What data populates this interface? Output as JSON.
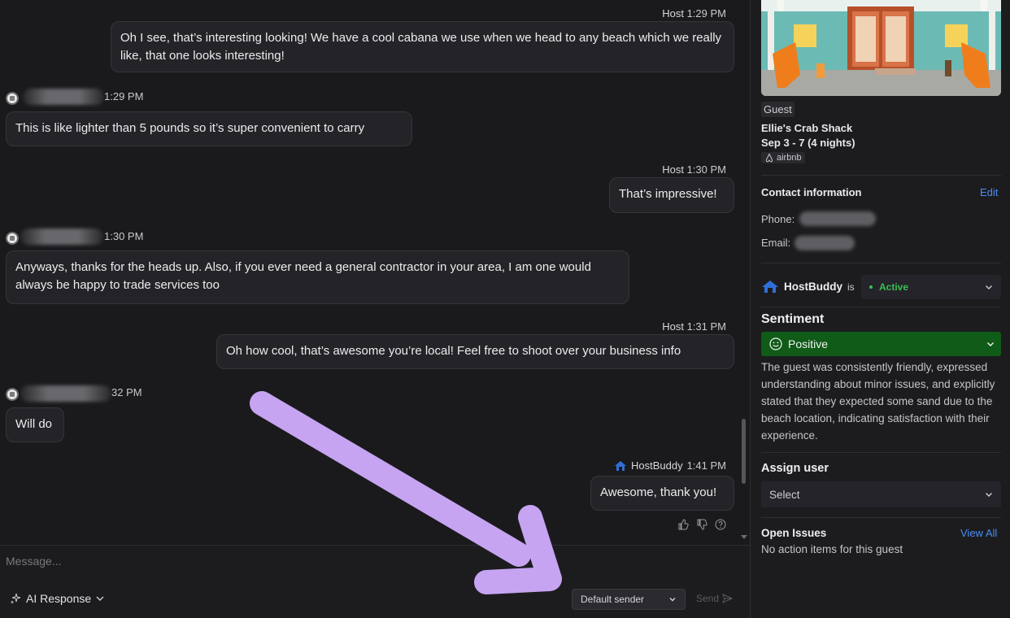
{
  "chat": {
    "messages": [
      {
        "sender": "Host",
        "time": "1:29 PM",
        "text": "Oh I see, that’s interesting looking! We have a cool cabana we use when we head to any beach which we really like, that one looks interesting!"
      },
      {
        "time": "1:29 PM",
        "text": "This is like lighter than 5 pounds so it’s super convenient to carry"
      },
      {
        "sender": "Host",
        "time": "1:30 PM",
        "text": "That’s impressive!"
      },
      {
        "time": "1:30 PM",
        "text": "Anyways, thanks for the heads up. Also, if you ever need a general contractor in your area, I am one would always be happy to trade services too"
      },
      {
        "sender": "Host",
        "time": "1:31 PM",
        "text": "Oh how cool, that’s awesome you’re local! Feel free to shoot over your business info"
      },
      {
        "time": "32 PM",
        "text": "Will do"
      },
      {
        "sender": "HostBuddy",
        "time": "1:41 PM",
        "text": "Awesome, thank you!"
      }
    ]
  },
  "composer": {
    "placeholder": "Message...",
    "ai_label": "AI Response",
    "sender_label": "Default sender",
    "send_label": "Send"
  },
  "panel": {
    "guest_tag": "Guest",
    "property_name": "Ellie's Crab Shack",
    "dates": "Sep 3 - 7 (4 nights)",
    "platform": "airbnb",
    "contact_title": "Contact information",
    "edit_label": "Edit",
    "phone_label": "Phone:",
    "email_label": "Email:",
    "hostbuddy_name": "HostBuddy",
    "hostbuddy_is": "is",
    "status": "Active",
    "sentiment_title": "Sentiment",
    "sentiment_value": "Positive",
    "sentiment_text": "The guest was consistently friendly, expressed understanding about minor issues, and explicitly stated that they expected some sand due to the beach location, indicating satisfaction with their experience.",
    "assign_title": "Assign user",
    "assign_placeholder": "Select",
    "issues_title": "Open Issues",
    "view_all": "View All",
    "issues_empty": "No action items for this guest"
  },
  "colors": {
    "accent_link": "#4c8df5",
    "status_active": "#3bbf52",
    "sentiment_positive_bg": "#0f5b17",
    "annotation_arrow": "#c6a4f1"
  }
}
